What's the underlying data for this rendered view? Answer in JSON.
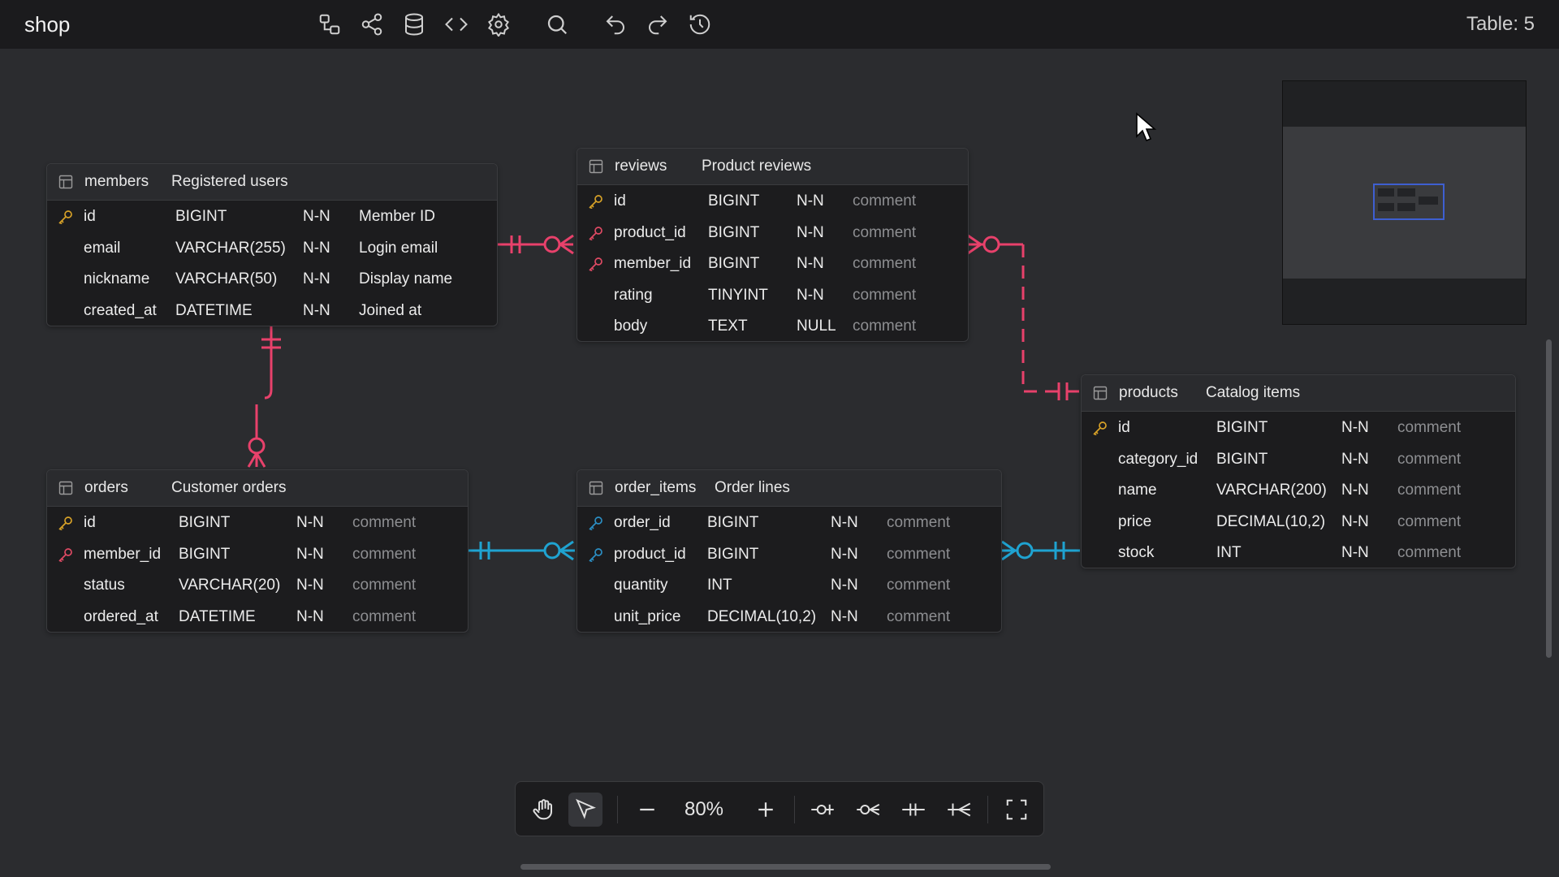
{
  "app": {
    "title": "shop",
    "table_count": "Table: 5"
  },
  "toolbar": {
    "icons": [
      "diagram-icon",
      "share-icon",
      "database-icon",
      "code-icon",
      "gear-icon",
      "search-icon",
      "undo-icon",
      "redo-icon",
      "history-icon"
    ]
  },
  "colors": {
    "relation_red": "#e8416b",
    "relation_blue": "#1fa3d1",
    "key_gold": "#d8a228",
    "fk_red": "#e04a64",
    "fk_blue": "#2b8fc4",
    "accent": "#3e5fd1"
  },
  "tables": {
    "members": {
      "name": "members",
      "comment": "Registered users",
      "rows": [
        {
          "col": "id",
          "type": "BIGINT",
          "nn": "N-N",
          "comment": "Member ID",
          "key": "pk"
        },
        {
          "col": "email",
          "type": "VARCHAR(255)",
          "nn": "N-N",
          "comment": "Login email",
          "key": ""
        },
        {
          "col": "nickname",
          "type": "VARCHAR(50)",
          "nn": "N-N",
          "comment": "Display name",
          "key": ""
        },
        {
          "col": "created_at",
          "type": "DATETIME",
          "nn": "N-N",
          "comment": "Joined at",
          "key": ""
        }
      ]
    },
    "reviews": {
      "name": "reviews",
      "comment": "Product reviews",
      "rows": [
        {
          "col": "id",
          "type": "BIGINT",
          "nn": "N-N",
          "comment": "comment",
          "key": "pk"
        },
        {
          "col": "product_id",
          "type": "BIGINT",
          "nn": "N-N",
          "comment": "comment",
          "key": "fk"
        },
        {
          "col": "member_id",
          "type": "BIGINT",
          "nn": "N-N",
          "comment": "comment",
          "key": "fk"
        },
        {
          "col": "rating",
          "type": "TINYINT",
          "nn": "N-N",
          "comment": "comment",
          "key": ""
        },
        {
          "col": "body",
          "type": "TEXT",
          "nn": "NULL",
          "comment": "comment",
          "key": ""
        }
      ]
    },
    "orders": {
      "name": "orders",
      "comment": "Customer orders",
      "rows": [
        {
          "col": "id",
          "type": "BIGINT",
          "nn": "N-N",
          "comment": "comment",
          "key": "pk"
        },
        {
          "col": "member_id",
          "type": "BIGINT",
          "nn": "N-N",
          "comment": "comment",
          "key": "fk"
        },
        {
          "col": "status",
          "type": "VARCHAR(20)",
          "nn": "N-N",
          "comment": "comment",
          "key": ""
        },
        {
          "col": "ordered_at",
          "type": "DATETIME",
          "nn": "N-N",
          "comment": "comment",
          "key": ""
        }
      ]
    },
    "order_items": {
      "name": "order_items",
      "comment": "Order lines",
      "rows": [
        {
          "col": "order_id",
          "type": "BIGINT",
          "nn": "N-N",
          "comment": "comment",
          "key": "pfk"
        },
        {
          "col": "product_id",
          "type": "BIGINT",
          "nn": "N-N",
          "comment": "comment",
          "key": "pfk"
        },
        {
          "col": "quantity",
          "type": "INT",
          "nn": "N-N",
          "comment": "comment",
          "key": ""
        },
        {
          "col": "unit_price",
          "type": "DECIMAL(10,2)",
          "nn": "N-N",
          "comment": "comment",
          "key": ""
        }
      ]
    },
    "products": {
      "name": "products",
      "comment": "Catalog items",
      "rows": [
        {
          "col": "id",
          "type": "BIGINT",
          "nn": "N-N",
          "comment": "comment",
          "key": "pk"
        },
        {
          "col": "category_id",
          "type": "BIGINT",
          "nn": "N-N",
          "comment": "comment",
          "key": ""
        },
        {
          "col": "name",
          "type": "VARCHAR(200)",
          "nn": "N-N",
          "comment": "comment",
          "key": ""
        },
        {
          "col": "price",
          "type": "DECIMAL(10,2)",
          "nn": "N-N",
          "comment": "comment",
          "key": ""
        },
        {
          "col": "stock",
          "type": "INT",
          "nn": "N-N",
          "comment": "comment",
          "key": ""
        }
      ]
    }
  },
  "zoombar": {
    "zoom": "80%",
    "icons": [
      "hand-icon",
      "pointer-icon",
      "zoom-out-icon",
      "zoom-in-icon",
      "one-or-zero-icon",
      "zero-or-many-icon",
      "exactly-one-icon",
      "one-or-many-icon",
      "fit-screen-icon"
    ]
  }
}
